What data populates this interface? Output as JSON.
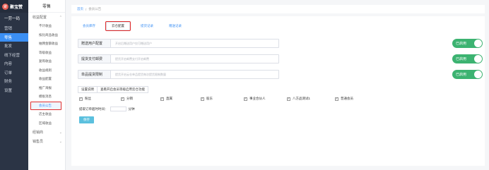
{
  "brand": {
    "logo_text": "聚宝赞",
    "logo_sub": "JUBAOZAN.COM"
  },
  "nav": {
    "top": "一劳一码",
    "items": [
      {
        "label": "营销",
        "active": false
      },
      {
        "label": "零售",
        "active": true
      },
      {
        "label": "批发",
        "active": false
      },
      {
        "label": "线下经营",
        "active": false
      },
      {
        "label": "内容",
        "active": false
      },
      {
        "label": "订单",
        "active": false
      },
      {
        "label": "财务",
        "active": false
      },
      {
        "label": "设置",
        "active": false
      }
    ]
  },
  "submenu": {
    "title": "零售",
    "group1": "收益配置",
    "items": [
      "不计收益",
      "按比商品收益",
      "抽佣金额收益",
      "等级收益",
      "复购收益",
      "收益规则",
      "收益配置",
      "推广海报",
      "模板消息",
      "会员公告",
      "店主收益",
      "区域收益"
    ],
    "selected_index": 9,
    "group2": "经销商",
    "group3": "销售员"
  },
  "breadcrumb": {
    "home": "首页",
    "sep": "/",
    "current": "会员公告"
  },
  "tabs": [
    "会员库存",
    "云仓配置",
    "提货记录",
    "赠送记录"
  ],
  "active_tab": 1,
  "settings": [
    {
      "label": "赠送用户配置",
      "placeholder": "开启后赠送用户仅可赠送用户",
      "toggle": "已启用"
    },
    {
      "label": "提货支付邮费",
      "placeholder": "提货开启邮费支付开启邮费",
      "toggle": "已启用"
    },
    {
      "label": "单品提货限制",
      "placeholder": "提货开启云仓单品提货每次提货限制数量",
      "toggle": "已启用"
    }
  ],
  "button_group": [
    "设置说明",
    "查看开启会员等级启用云仓功能"
  ],
  "checkboxes": [
    "粉丝",
    "分销",
    "直属",
    "股东",
    "事业合伙人",
    "八方品测试1",
    "普通会员"
  ],
  "timeout": {
    "label": "提取订单超时时间：",
    "unit": "分钟",
    "value": ""
  },
  "save_label": "保存",
  "colors": {
    "accent": "#3b8ff4",
    "toggle_on": "#3cb371",
    "highlight": "#e02c2c",
    "save": "#5bc0de"
  }
}
